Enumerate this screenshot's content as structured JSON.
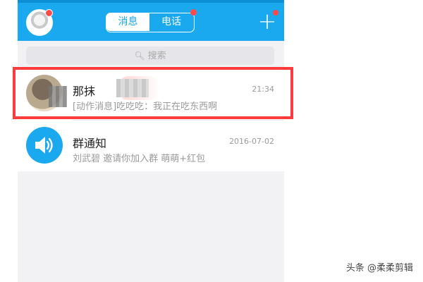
{
  "header": {
    "tabs": [
      {
        "label": "消息",
        "active": true
      },
      {
        "label": "电话",
        "active": false,
        "has_badge": true
      }
    ],
    "add_label": "+",
    "avatar_icon": "user-avatar",
    "accent_color": "#1aa9ef",
    "badge_color": "#ff4a4a"
  },
  "search": {
    "placeholder": "搜索",
    "icon": "search-icon"
  },
  "conversations": [
    {
      "title": "那抹",
      "subtitle": "[动作消息]吃吃吃：我正在吃东西啊",
      "time": "21:34",
      "avatar_icon": "contact-avatar"
    },
    {
      "title": "群通知",
      "subtitle": "刘武碧 邀请你加入群 萌萌+红包",
      "time": "2016-07-02",
      "avatar_icon": "speaker-icon"
    }
  ],
  "highlight_color": "#ff3b3b",
  "watermark": "头条 @柔柔剪辑"
}
